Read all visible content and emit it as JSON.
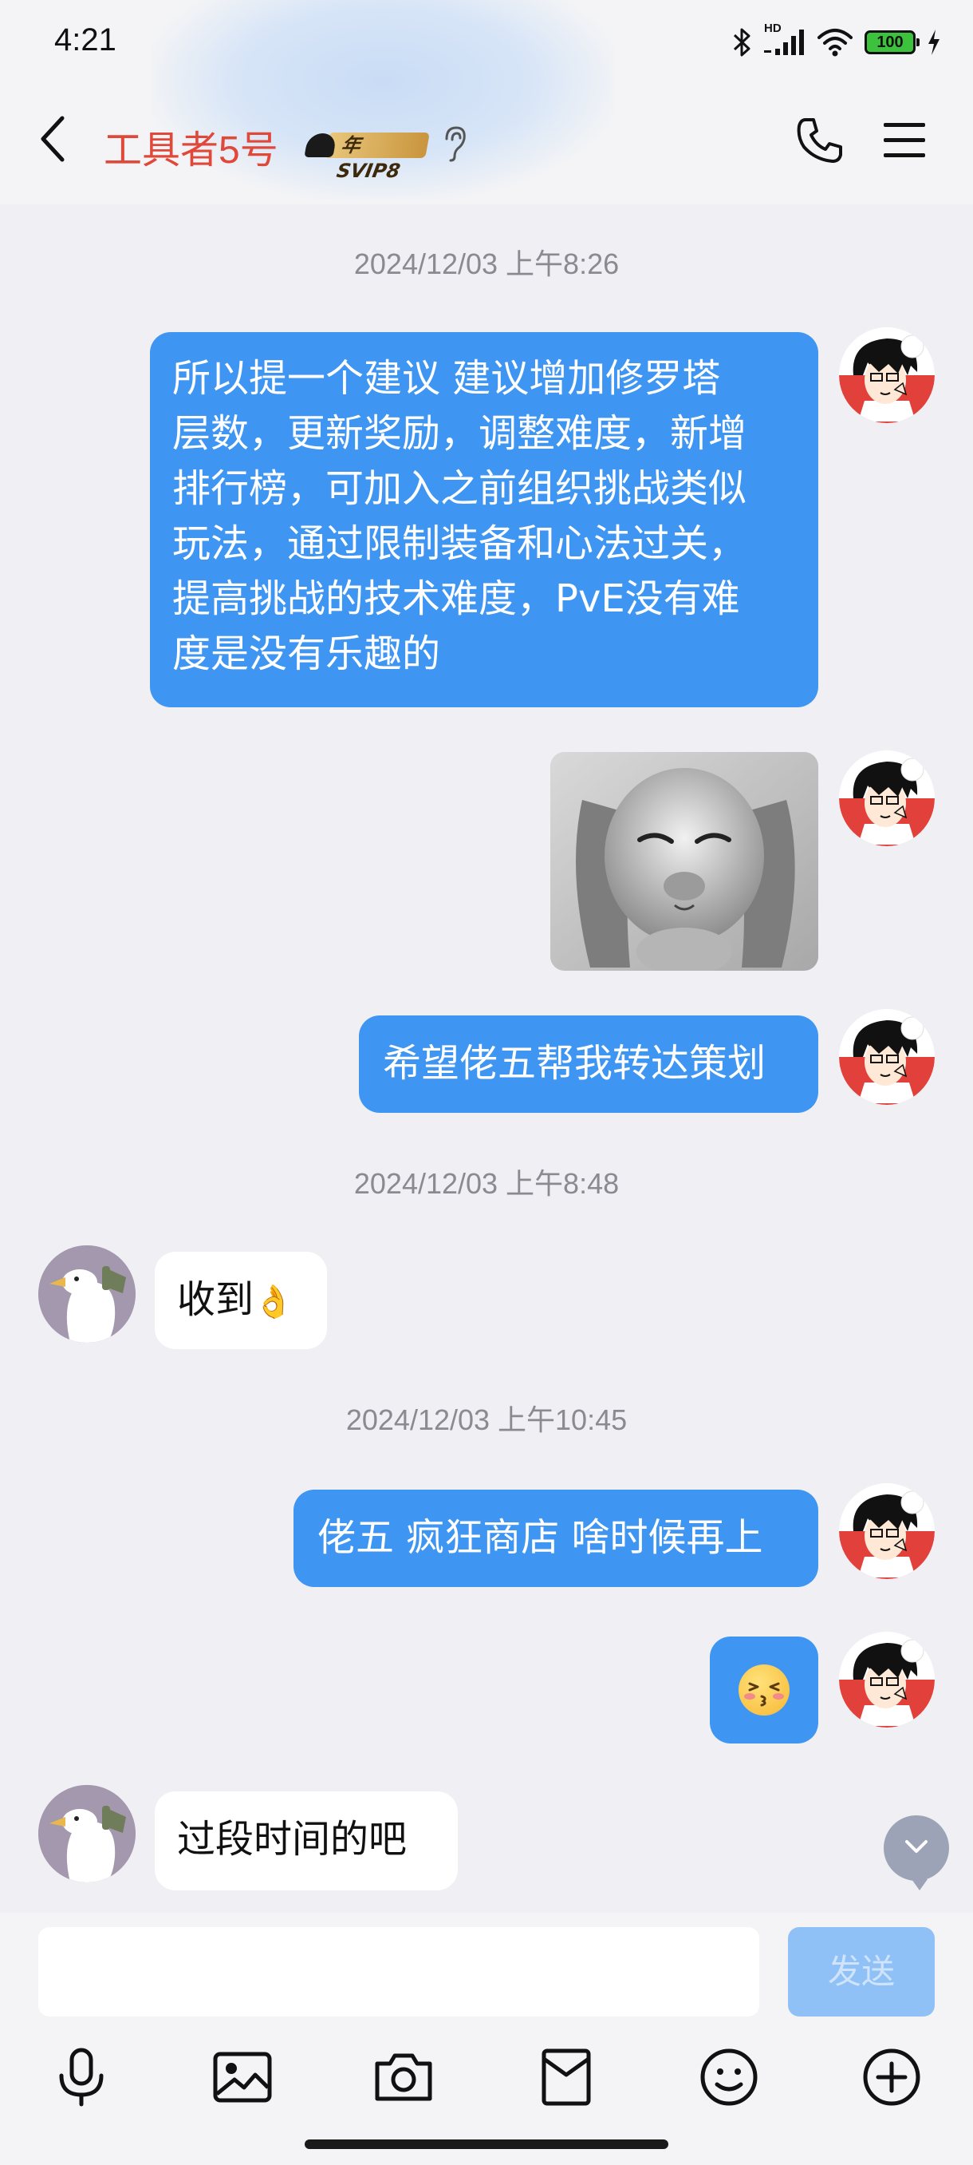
{
  "status_bar": {
    "time": "4:21",
    "network_label": "HD",
    "battery": "100",
    "icons": [
      "bluetooth-icon",
      "signal-icon",
      "wifi-icon",
      "battery-icon",
      "charging-icon"
    ]
  },
  "header": {
    "contact_name": "工具者5号",
    "badge_text": "年SVIP8",
    "icons": [
      "back-icon",
      "ear-icon",
      "phone-icon",
      "menu-icon"
    ]
  },
  "messages": [
    {
      "type": "timestamp",
      "text": "2024/12/03 上午8:26"
    },
    {
      "type": "text",
      "direction": "out",
      "lines": [
        "所以提一个建议 建议增加修罗塔",
        "层数，更新奖励，调整难度，新增",
        "排行榜，可加入之前组织挑战类似",
        "玩法，通过限制装备和心法过关，",
        "提高挑战的技术难度，PvE没有难",
        "度是没有乐趣的"
      ]
    },
    {
      "type": "sticker",
      "direction": "out",
      "description": "rabbit-sticker"
    },
    {
      "type": "text",
      "direction": "out",
      "text": "希望佬五帮我转达策划"
    },
    {
      "type": "timestamp",
      "text": "2024/12/03 上午8:48"
    },
    {
      "type": "text",
      "direction": "in",
      "text": "收到👌"
    },
    {
      "type": "timestamp",
      "text": "2024/12/03 上午10:45"
    },
    {
      "type": "text",
      "direction": "out",
      "text": "佬五 疯狂商店 啥时候再上"
    },
    {
      "type": "emoji",
      "direction": "out",
      "description": "kissing-face-emoji"
    },
    {
      "type": "text",
      "direction": "in",
      "text": "过段时间的吧"
    }
  ],
  "msg": {
    "ts1": "2024/12/03 上午8:26",
    "long_lines": [
      "所以提一个建议 建议增加修罗塔",
      "层数，更新奖励，调整难度，新增",
      "排行榜，可加入之前组织挑战类似",
      "玩法，通过限制装备和心法过关，",
      "提高挑战的技术难度，PvE没有难",
      "度是没有乐趣的"
    ],
    "relay": "希望佬五帮我转达策划",
    "ts2": "2024/12/03 上午8:48",
    "received": "收到",
    "ok_emoji": "👌",
    "ts3": "2024/12/03 上午10:45",
    "shop": "佬五 疯狂商店 啥时候再上",
    "later": "过段时间的吧"
  },
  "input_bar": {
    "input_value": "",
    "input_placeholder": "",
    "send_label": "发送",
    "tools": [
      "microphone-icon",
      "image-icon",
      "camera-icon",
      "red-packet-icon",
      "emoji-icon",
      "plus-icon"
    ]
  },
  "colors": {
    "outgoing_bubble": "#3f95f2",
    "incoming_bubble": "#ffffff",
    "contact_name": "#e0483a",
    "background": "#efeff4",
    "send_button_disabled": "#8fc1f7"
  }
}
